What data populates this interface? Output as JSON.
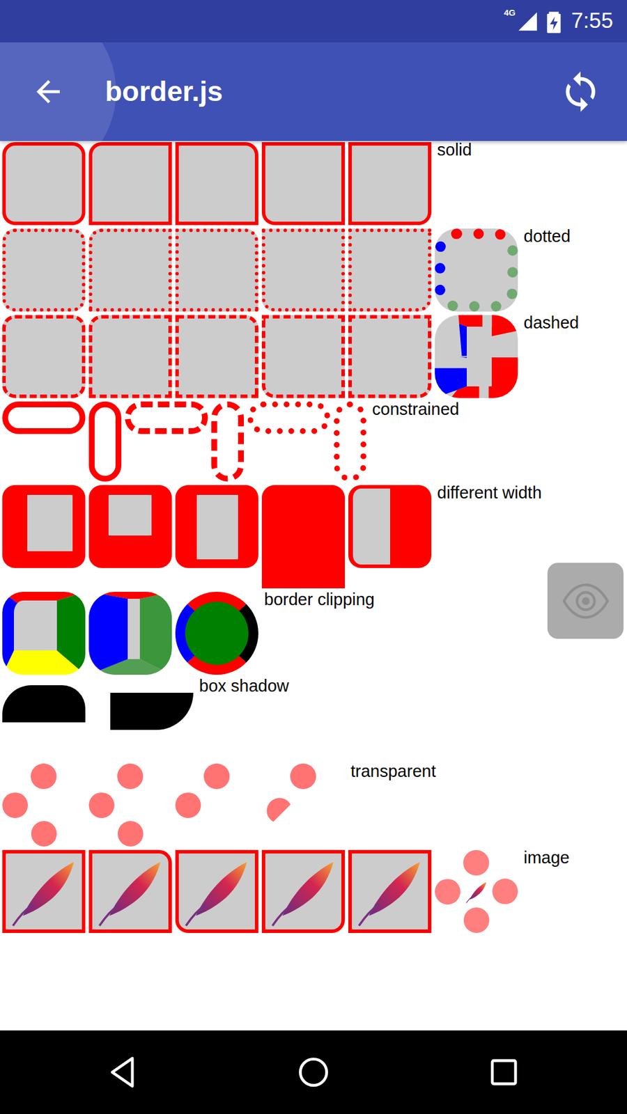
{
  "status_bar": {
    "network": "4G",
    "time": "7:55"
  },
  "app_bar": {
    "title": "border.js"
  },
  "sections": [
    {
      "label": "solid",
      "boxes": [
        {
          "kind": "solid-all"
        },
        {
          "kind": "solid-tl"
        },
        {
          "kind": "solid-tr"
        },
        {
          "kind": "solid-bl"
        },
        {
          "kind": "solid-br"
        }
      ]
    },
    {
      "label": "dotted",
      "boxes": [
        {
          "kind": "dotted-all"
        },
        {
          "kind": "dotted-tl"
        },
        {
          "kind": "dotted-tr"
        },
        {
          "kind": "dotted-bl"
        },
        {
          "kind": "dotted-br"
        },
        {
          "kind": "dotted-multi"
        }
      ]
    },
    {
      "label": "dashed",
      "boxes": [
        {
          "kind": "dashed-all"
        },
        {
          "kind": "dashed-tl"
        },
        {
          "kind": "dashed-tr"
        },
        {
          "kind": "dashed-bl"
        },
        {
          "kind": "dashed-br"
        },
        {
          "kind": "dashed-multi"
        }
      ]
    },
    {
      "label": "constrained",
      "boxes": [
        {
          "kind": "solid-pillh"
        },
        {
          "kind": "solid-pillv"
        },
        {
          "kind": "dashed-pillh"
        },
        {
          "kind": "dashed-pillv"
        },
        {
          "kind": "dotted-pillh"
        },
        {
          "kind": "dotted-pillv"
        }
      ]
    },
    {
      "label": "different width",
      "boxes": [
        {
          "kind": "width-a"
        },
        {
          "kind": "width-b"
        },
        {
          "kind": "width-c"
        },
        {
          "kind": "width-d"
        },
        {
          "kind": "width-e"
        }
      ]
    },
    {
      "label": "border clipping",
      "boxes": [
        {
          "kind": "clip-a"
        },
        {
          "kind": "clip-b"
        },
        {
          "kind": "clip-c"
        }
      ]
    },
    {
      "label": "box shadow",
      "boxes": [
        {
          "kind": "shadow-a"
        },
        {
          "kind": "shadow-b"
        }
      ]
    },
    {
      "label": "transparent",
      "boxes": [
        {
          "kind": "trans-a"
        },
        {
          "kind": "trans-b"
        },
        {
          "kind": "trans-c"
        },
        {
          "kind": "trans-d"
        }
      ]
    },
    {
      "label": "image",
      "boxes": [
        {
          "kind": "image-none"
        },
        {
          "kind": "image-tr"
        },
        {
          "kind": "image-bl"
        },
        {
          "kind": "image-br"
        },
        {
          "kind": "image-none"
        },
        {
          "kind": "image-ring"
        }
      ]
    }
  ]
}
